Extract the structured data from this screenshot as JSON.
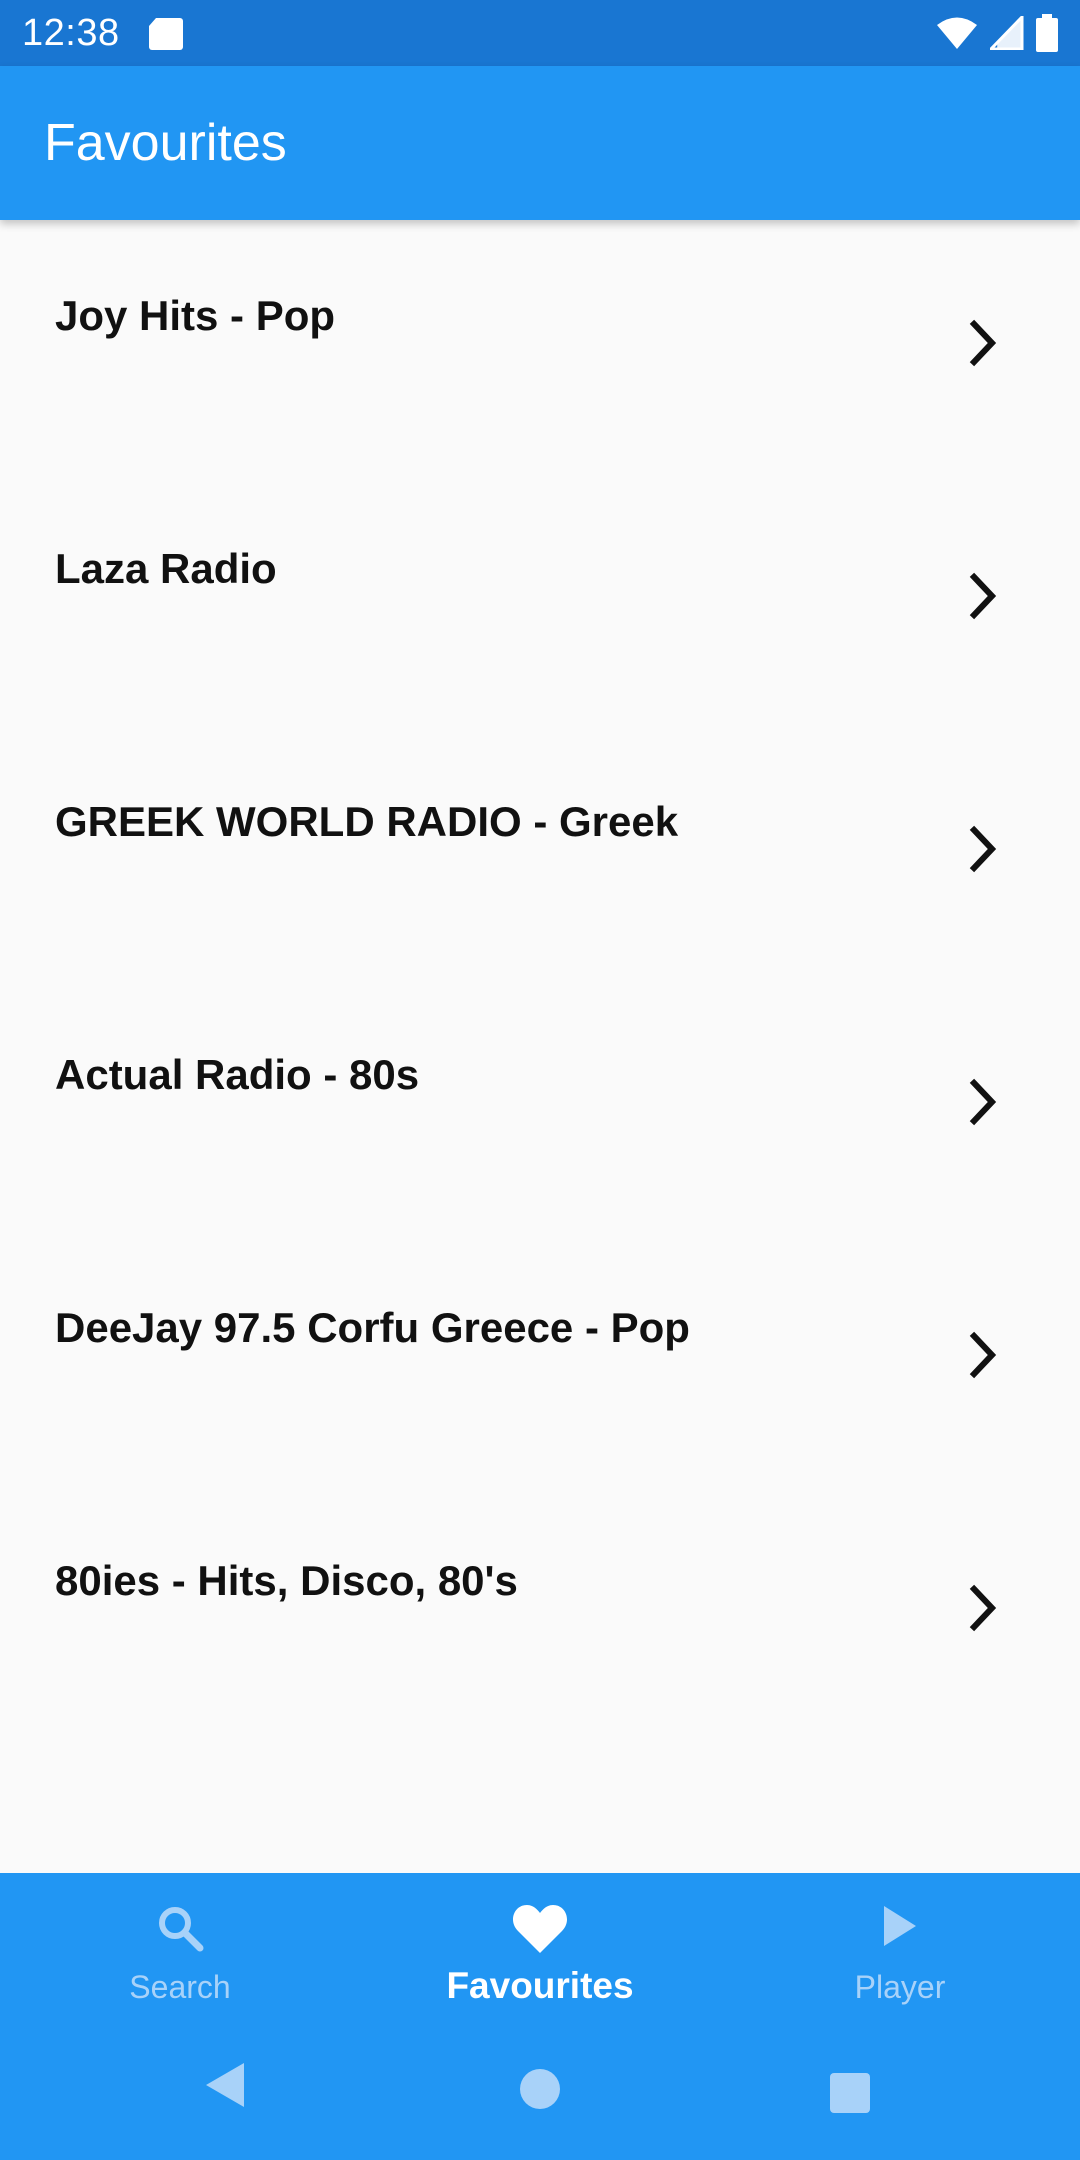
{
  "status_bar": {
    "time": "12:38",
    "icons": [
      "sd-card-icon",
      "wifi-icon",
      "signal-icon",
      "battery-icon"
    ]
  },
  "app_bar": {
    "title": "Favourites"
  },
  "stations": [
    {
      "name": "Joy Hits - Pop"
    },
    {
      "name": "Laza Radio"
    },
    {
      "name": "GREEK WORLD RADIO - Greek"
    },
    {
      "name": "Actual Radio - 80s"
    },
    {
      "name": "DeeJay 97.5 Corfu Greece - Pop"
    },
    {
      "name": "80ies - Hits, Disco, 80's"
    }
  ],
  "bottom_nav": {
    "items": [
      {
        "label": "Search",
        "icon": "search-icon",
        "active": false
      },
      {
        "label": "Favourites",
        "icon": "heart-icon",
        "active": true
      },
      {
        "label": "Player",
        "icon": "play-icon",
        "active": false
      }
    ]
  },
  "system_nav": {
    "icons": [
      "back-icon",
      "home-icon",
      "recents-icon"
    ]
  },
  "colors": {
    "primary": "#2196f3",
    "primary_dark": "#1976d2",
    "background": "#fafafa",
    "inactive_nav": "#a8d2f9"
  }
}
